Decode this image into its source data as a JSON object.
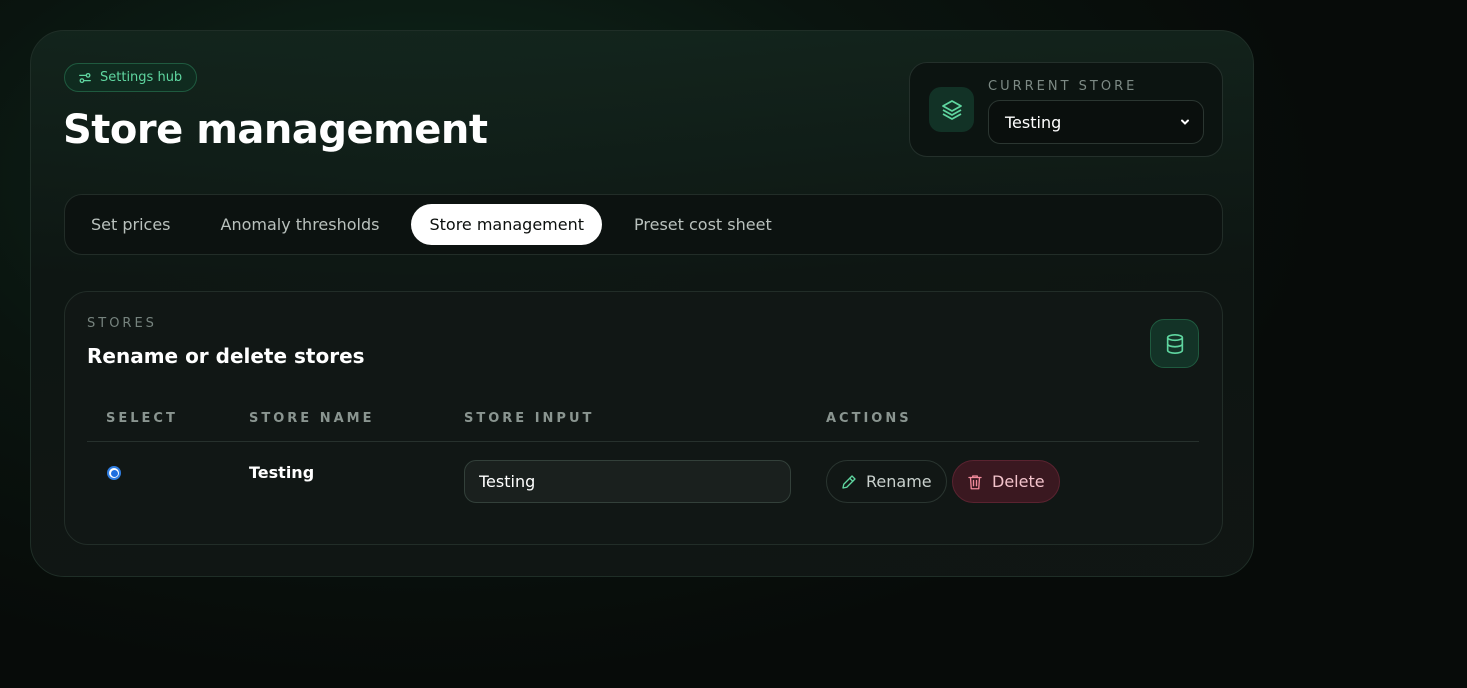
{
  "header": {
    "badge_label": "Settings hub",
    "title": "Store management"
  },
  "current_store": {
    "label": "CURRENT STORE",
    "selected": "Testing"
  },
  "tabs": [
    {
      "label": "Set prices",
      "active": false
    },
    {
      "label": "Anomaly thresholds",
      "active": false
    },
    {
      "label": "Store management",
      "active": true
    },
    {
      "label": "Preset cost sheet",
      "active": false
    }
  ],
  "stores_section": {
    "label": "STORES",
    "title": "Rename or delete stores",
    "columns": [
      "SELECT",
      "STORE NAME",
      "STORE INPUT",
      "ACTIONS"
    ],
    "rows": [
      {
        "selected": true,
        "name": "Testing",
        "input_value": "Testing"
      }
    ],
    "rename_label": "Rename",
    "delete_label": "Delete"
  },
  "colors": {
    "accent": "#5fd6a0",
    "danger": "#f3c3cb",
    "active_tab_bg": "#ffffff"
  }
}
